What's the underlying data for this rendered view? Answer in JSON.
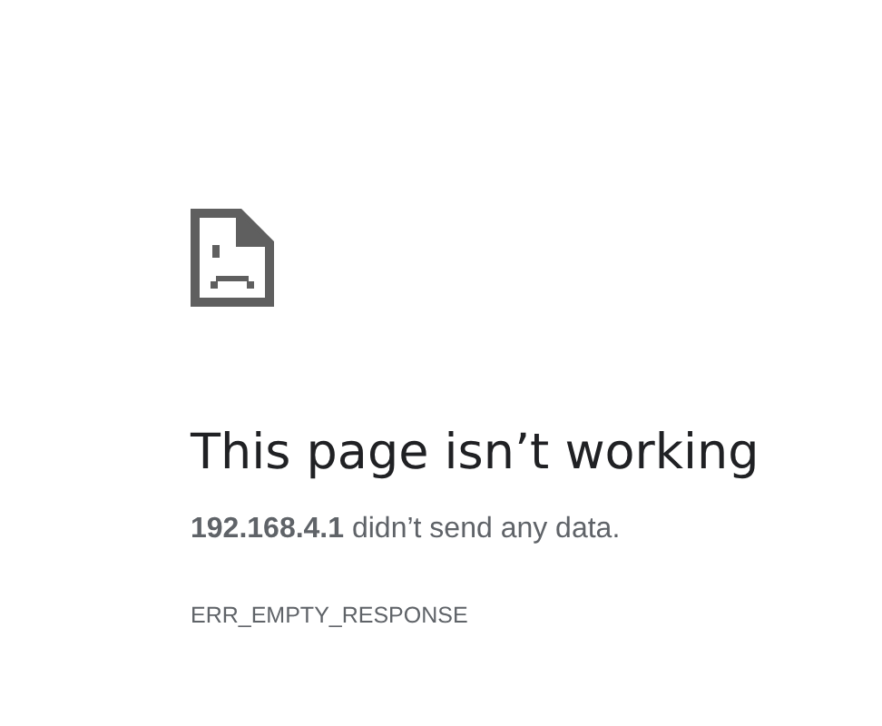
{
  "heading": "This page isn’t working",
  "message": "**192.168.4.1** didn’t send any data.",
  "error_code": "ERR_EMPTY_RESPONSE"
}
